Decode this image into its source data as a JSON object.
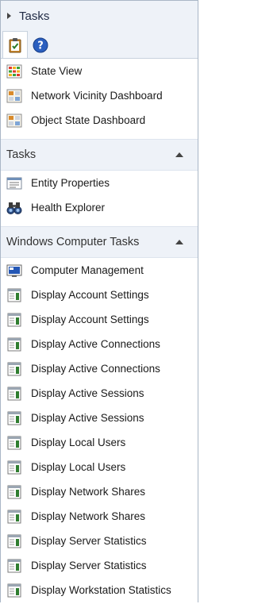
{
  "pane": {
    "title": "Tasks"
  },
  "tabs": [
    {
      "icon": "clipboard-tasks-icon"
    },
    {
      "icon": "help-icon"
    }
  ],
  "views": [
    {
      "label": "State View",
      "icon": "state-view-icon"
    },
    {
      "label": "Network Vicinity Dashboard",
      "icon": "dashboard-icon"
    },
    {
      "label": "Object State Dashboard",
      "icon": "dashboard-icon"
    }
  ],
  "tasks_section": {
    "title": "Tasks",
    "items": [
      {
        "label": "Entity Properties",
        "icon": "properties-icon"
      },
      {
        "label": "Health Explorer",
        "icon": "binoculars-icon"
      }
    ]
  },
  "windows_section": {
    "title": "Windows Computer Tasks",
    "items": [
      {
        "label": "Computer Management",
        "icon": "computer-management-icon"
      },
      {
        "label": "Display Account Settings",
        "icon": "task-console-icon"
      },
      {
        "label": "Display Account Settings",
        "icon": "task-console-icon"
      },
      {
        "label": "Display Active Connections",
        "icon": "task-console-icon"
      },
      {
        "label": "Display Active Connections",
        "icon": "task-console-icon"
      },
      {
        "label": "Display Active Sessions",
        "icon": "task-console-icon"
      },
      {
        "label": "Display Active Sessions",
        "icon": "task-console-icon"
      },
      {
        "label": "Display Local Users",
        "icon": "task-console-icon"
      },
      {
        "label": "Display Local Users",
        "icon": "task-console-icon"
      },
      {
        "label": "Display Network Shares",
        "icon": "task-console-icon"
      },
      {
        "label": "Display Network Shares",
        "icon": "task-console-icon"
      },
      {
        "label": "Display Server Statistics",
        "icon": "task-console-icon"
      },
      {
        "label": "Display Server Statistics",
        "icon": "task-console-icon"
      },
      {
        "label": "Display Workstation Statistics",
        "icon": "task-console-icon"
      }
    ]
  }
}
